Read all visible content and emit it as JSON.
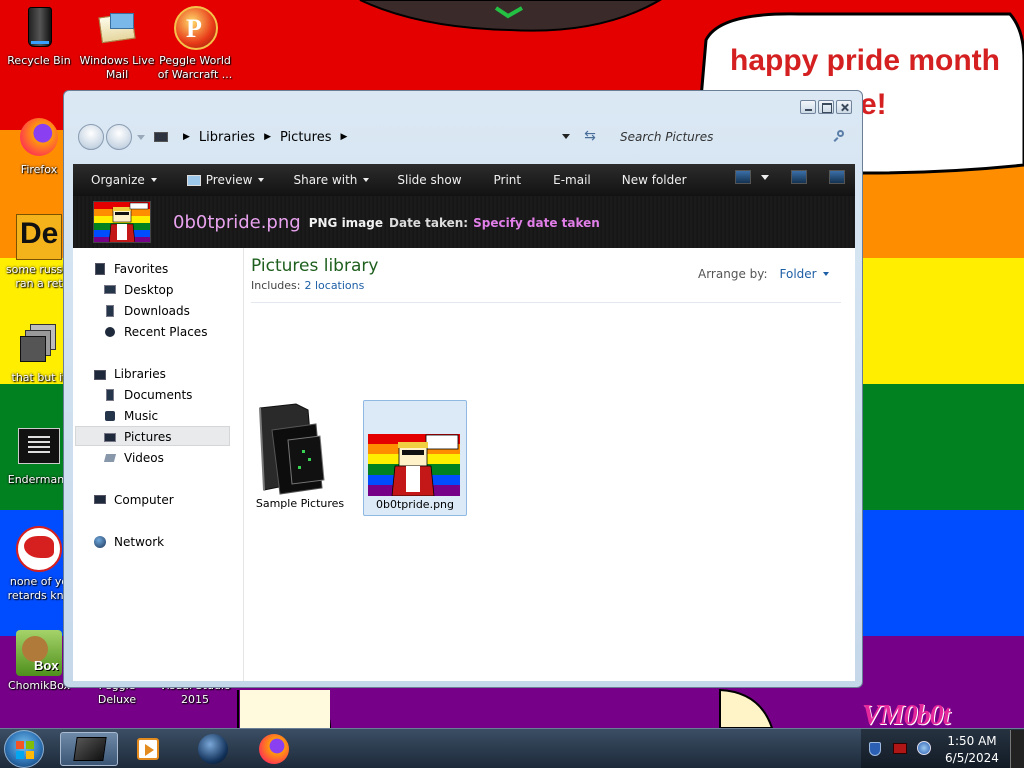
{
  "wallpaper": {
    "bubble_text": "happy pride month",
    "bubble_text_line2": "e!",
    "signature": "VM0b0t",
    "stripe_colors": [
      "#e50000",
      "#ff8d00",
      "#ffee00",
      "#028121",
      "#004cff",
      "#770088"
    ]
  },
  "desktop_icons": [
    {
      "label": "Recycle Bin",
      "icon": "recycle-bin-icon"
    },
    {
      "label": "Windows Live\nMail",
      "icon": "mail-icon"
    },
    {
      "label": "Peggle World\nof Warcraft ...",
      "icon": "peggle-icon"
    },
    {
      "label": "Firefox",
      "icon": "firefox-icon"
    },
    {
      "label": "some russia\nran a ret",
      "icon": "de-icon"
    },
    {
      "label": "that but it",
      "icon": "stack-icon"
    },
    {
      "label": "Endermanc",
      "icon": "console-icon"
    },
    {
      "label": "none of yo\nretards kno",
      "icon": "dino-icon"
    },
    {
      "label": "ChomikBox",
      "icon": "chomikbox-icon"
    },
    {
      "label": "Peggle Deluxe",
      "icon": "peggle-deluxe-icon"
    },
    {
      "label": "Visual Studio\n2015",
      "icon": "visual-studio-icon"
    }
  ],
  "window": {
    "breadcrumb": [
      "Libraries",
      "Pictures"
    ],
    "search_placeholder": "Search Pictures",
    "commands": {
      "organize": "Organize",
      "preview": "Preview",
      "share_with": "Share with",
      "slide_show": "Slide show",
      "print": "Print",
      "email": "E-mail",
      "new_folder": "New folder"
    },
    "details": {
      "filename": "0b0tpride.png",
      "type": "PNG image",
      "date_label": "Date taken:",
      "date_value": "Specify date taken"
    },
    "nav": {
      "favorites": "Favorites",
      "desktop": "Desktop",
      "downloads": "Downloads",
      "recent_places": "Recent Places",
      "libraries": "Libraries",
      "documents": "Documents",
      "music": "Music",
      "pictures": "Pictures",
      "videos": "Videos",
      "computer": "Computer",
      "network": "Network"
    },
    "library": {
      "title": "Pictures library",
      "includes_label": "Includes:",
      "includes_link": "2 locations",
      "arrange_label": "Arrange by:",
      "arrange_value": "Folder"
    },
    "files": [
      {
        "name": "Sample Pictures",
        "kind": "folder"
      },
      {
        "name": "0b0tpride.png",
        "kind": "image",
        "selected": true
      }
    ]
  },
  "taskbar": {
    "time": "1:50 AM",
    "date": "6/5/2024"
  }
}
